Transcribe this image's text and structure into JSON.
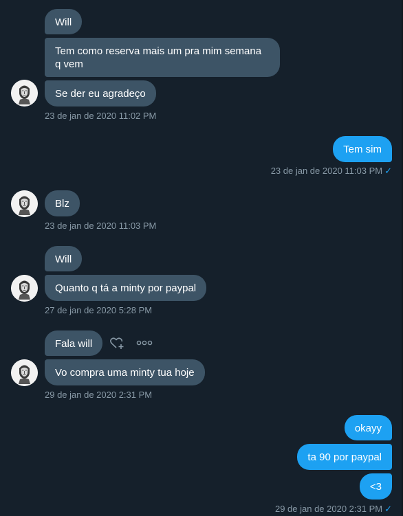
{
  "colors": {
    "background": "#15202b",
    "incoming_bubble": "#3d5466",
    "outgoing_bubble": "#1da1f2",
    "timestamp": "#8899a6",
    "read_check": "#1da1f2"
  },
  "messages": {
    "m1": "Will",
    "m2": "Tem como reserva mais um pra mim semana q vem",
    "m3": "Se der eu agradeço",
    "ts1": "23 de jan de 2020 11:02 PM",
    "m4": "Tem sim",
    "ts2": "23 de jan de 2020 11:03 PM",
    "m5": "Blz",
    "ts3": "23 de jan de 2020 11:03 PM",
    "m6": "Will",
    "m7": "Quanto q tá a minty por paypal",
    "ts4": "27 de jan de 2020 5:28 PM",
    "m8": "Fala will",
    "m9": "Vo compra uma minty tua hoje",
    "ts5": "29 de jan de 2020 2:31 PM",
    "m10": "okayy",
    "m11": "ta 90 por paypal",
    "m12": "<3",
    "ts6": "29 de jan de 2020 2:31 PM"
  },
  "icons": {
    "read_check": "✓",
    "like": "heart-plus-icon",
    "more": "more-dots-icon"
  }
}
